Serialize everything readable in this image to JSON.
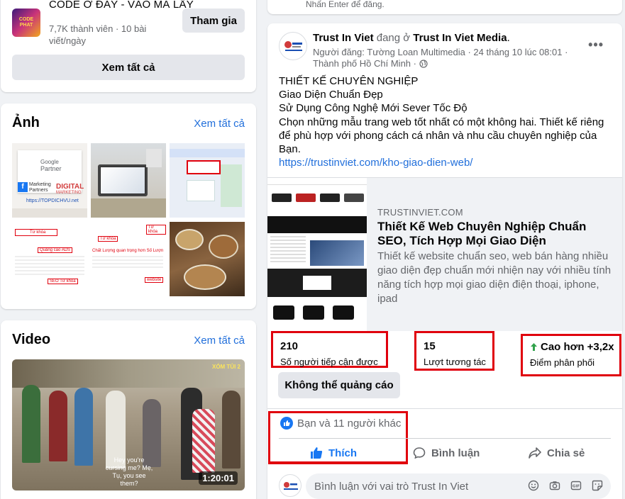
{
  "group_card": {
    "group_name": "CODE Ở ĐÂY - VÀO MÀ LẤY",
    "meta": "7,7K thành viên · 10 bài viết/ngày",
    "join_label": "Tham gia",
    "see_all_label": "Xem tất cả",
    "thumb_text": "CODE PHAT"
  },
  "photos_card": {
    "title": "Ảnh",
    "see_all_label": "Xem tất cả",
    "photo1_lines": [
      "Google",
      "Partner",
      "Marketing",
      "Partners",
      "DIGITAL",
      "MARKETING",
      "https://TOPDICHVU.net"
    ],
    "photo4_labels": [
      "Từ khóa",
      "Quảng cáo ADS",
      "SEO Từ khóa"
    ],
    "photo5_labels": [
      "Từ khóa",
      "Chất Lượng quan trọng hơn Số Lượn",
      "Từ khóa",
      "website"
    ]
  },
  "video_card": {
    "title": "Video",
    "see_all_label": "Xem tất cả",
    "duration": "1:20:01",
    "subtitle": "Hey you're cursing me? Mẹ, Tụ, you see them?",
    "badge": "XÓM TỦI 2"
  },
  "top_card": {
    "note": "Nhấn Enter để đăng."
  },
  "post": {
    "page_name": "Trust In Viet",
    "at_text": "đang ở",
    "location_page": "Trust In Viet Media",
    "meta_line1": "Người đăng: Tường Loan Multimedia · 24 tháng 10 lúc 08:01 ·",
    "meta_line2": "Thành phố Hồ Chí Minh ·",
    "more_label": "•••",
    "body_lines": [
      "THIẾT KẾ CHUYÊN NGHIỆP",
      "Giao Diện Chuẩn Đẹp",
      "Sử Dụng Công Nghệ Mới Sever Tốc Độ",
      "Chọn những mẫu trang web tốt nhất có một không hai. Thiết kế riêng để phù hợp với phong cách cá nhân và nhu cầu chuyên nghiệp của Bạn."
    ],
    "link_url": "https://trustinviet.com/kho-giao-dien-web/",
    "preview": {
      "domain": "TRUSTINVIET.COM",
      "title": "Thiết Kế Web Chuyên Nghiệp Chuẩn SEO, Tích Hợp Mọi Giao Diện",
      "description": "Thiết kế website chuẩn seo, web bán hàng nhiều giao diện đẹp chuẩn mới nhiện nay với nhiều tính năng tích hợp mọi giao diện điện thoại, iphone, ipad"
    },
    "stats": [
      {
        "value": "210",
        "label": "Số người tiếp cận được"
      },
      {
        "value": "15",
        "label": "Lượt tương tác"
      },
      {
        "value": "Cao hơn +3,2x",
        "label": "Điểm phân phối"
      }
    ],
    "no_ad_label": "Không thể quảng cáo",
    "reactions_text": "Bạn và 11 người khác",
    "actions": {
      "like": "Thích",
      "comment": "Bình luận",
      "share": "Chia sẻ"
    },
    "comment_placeholder": "Bình luận với vai trò Trust In Viet"
  },
  "colors": {
    "accent": "#1877f2",
    "link": "#216fdb",
    "highlight_box": "#e0000d",
    "up_arrow": "#31a24c"
  }
}
